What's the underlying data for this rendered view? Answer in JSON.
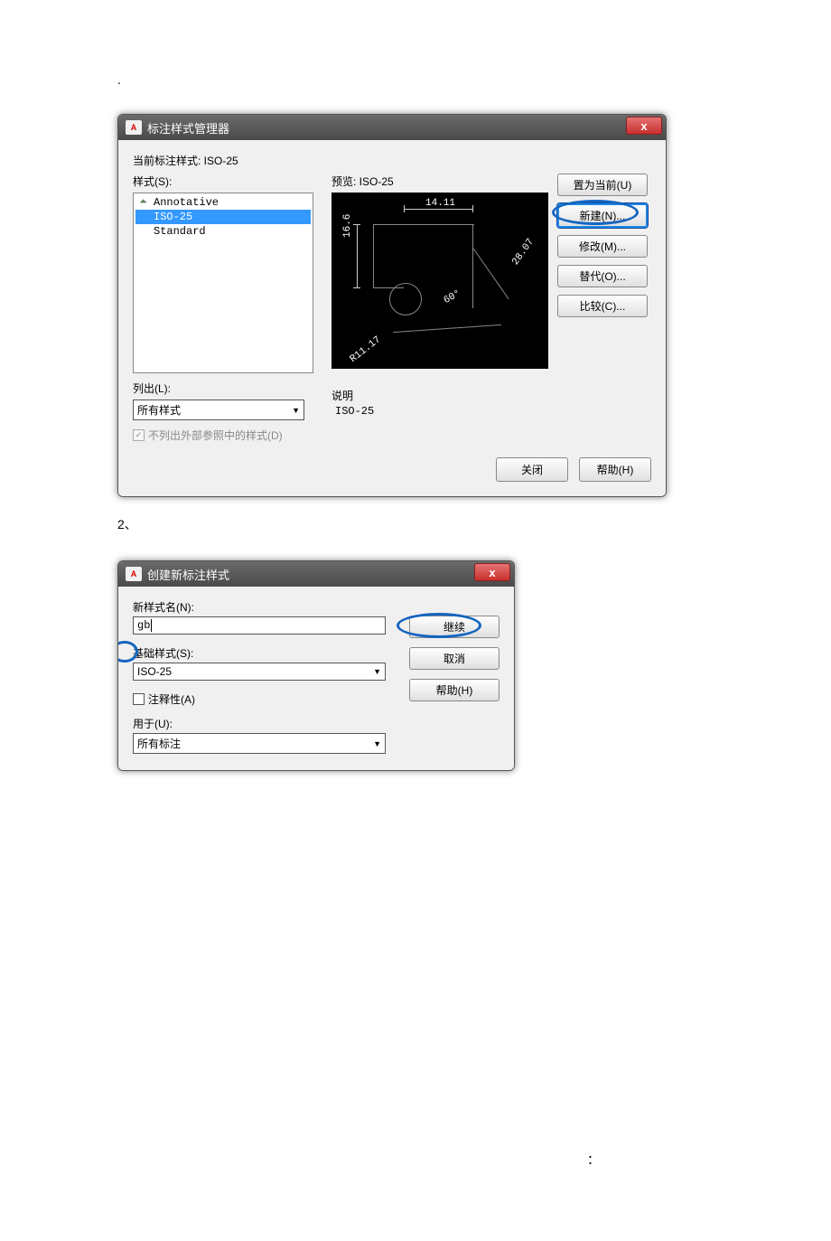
{
  "page_marker_dot": ".",
  "dialog1": {
    "title": "标注样式管理器",
    "close_x": "x",
    "current_style_label": "当前标注样式: ISO-25",
    "styles_label": "样式(S):",
    "preview_label": "预览: ISO-25",
    "list_items": [
      "Annotative",
      "ISO-25",
      "Standard"
    ],
    "dims": {
      "top": "14.11",
      "left": "16.6",
      "diag": "28.07",
      "angle": "60°",
      "radius": "R11.17"
    },
    "buttons": {
      "set_current": "置为当前(U)",
      "new": "新建(N)...",
      "modify": "修改(M)...",
      "override": "替代(O)...",
      "compare": "比较(C)..."
    },
    "desc_label": "说明",
    "desc_text": "ISO-25",
    "list_label": "列出(L):",
    "list_value": "所有样式",
    "checkbox_label": "不列出外部参照中的样式(D)",
    "close_btn": "关闭",
    "help_btn": "帮助(H)"
  },
  "step2_label": "2、",
  "dialog2": {
    "title": "创建新标注样式",
    "close_x": "x",
    "new_name_label": "新样式名(N):",
    "new_name_value": "gb",
    "base_label": "基础样式(S):",
    "base_value": "ISO-25",
    "annotative_label": "注释性(A)",
    "use_for_label": "用于(U):",
    "use_for_value": "所有标注",
    "continue_btn": "继续",
    "cancel_btn": "取消",
    "help_btn": "帮助(H)"
  },
  "colon_marker": "："
}
